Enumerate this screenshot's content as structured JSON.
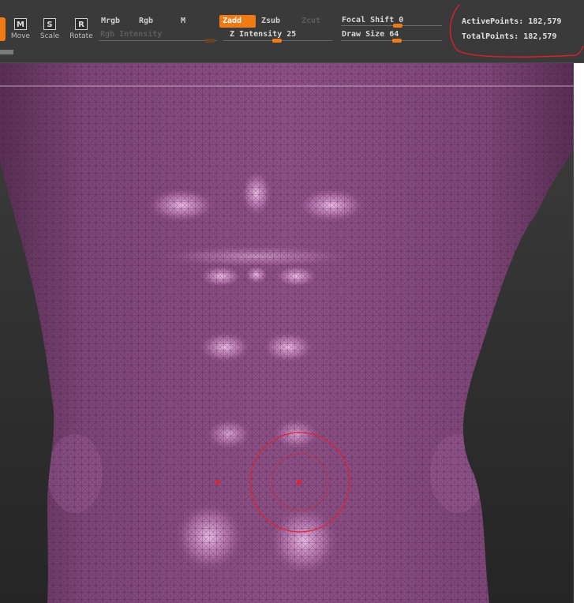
{
  "toolbar": {
    "tools": [
      {
        "letter": "M",
        "label": "Move"
      },
      {
        "letter": "S",
        "label": "Scale"
      },
      {
        "letter": "R",
        "label": "Rotate"
      }
    ],
    "color_modes": {
      "mrgb": "Mrgb",
      "rgb": "Rgb",
      "m": "M"
    },
    "rgb_intensity": {
      "label": "Rgb Intensity"
    },
    "sculpt_modes": {
      "zadd": "Zadd",
      "zsub": "Zsub",
      "zcut": "Zcut"
    },
    "z_intensity": {
      "label": "Z Intensity",
      "value": "25"
    },
    "focal_shift": {
      "label": "Focal Shift",
      "value": "0"
    },
    "draw_size": {
      "label": "Draw Size",
      "value": "64"
    }
  },
  "stats": {
    "active_points": "ActivePoints: 182,579",
    "total_points": "TotalPoints: 182,579"
  },
  "colors": {
    "accent": "#f07a13",
    "mesh": "#8d4f86",
    "mesh_highlight": "#e3aede",
    "annotation": "#d8232a",
    "brush_cursor": "#e0222e"
  }
}
